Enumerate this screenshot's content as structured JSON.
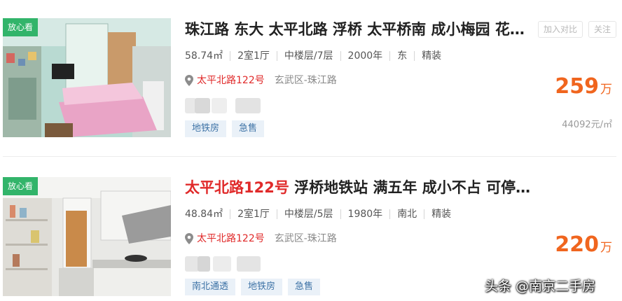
{
  "listings": [
    {
      "badge": "放心看",
      "title": "珠江路 东大 太平北路 浮桥 太平桥南 成小梅园 花…",
      "title_highlight": "",
      "meta": [
        "58.74㎡",
        "2室1厅",
        "中楼层/7层",
        "2000年",
        "东",
        "精装"
      ],
      "address": "太平北路122号",
      "district": "玄武区-珠江路",
      "tags": [
        "地铁房",
        "急售"
      ],
      "price": "259",
      "price_unit": "万",
      "unit_price": "44092元/㎡",
      "compare_label": "加入对比",
      "follow_label": "关注"
    },
    {
      "badge": "放心看",
      "title_highlight": "太平北路122号",
      "title": " 浮桥地铁站 满五年 成小不占 可停…",
      "meta": [
        "48.84㎡",
        "2室1厅",
        "中楼层/5层",
        "1980年",
        "南北",
        "精装"
      ],
      "address": "太平北路122号",
      "district": "玄武区-珠江路",
      "tags": [
        "南北通透",
        "地铁房",
        "急售"
      ],
      "price": "220",
      "price_unit": "万"
    }
  ],
  "watermark": "头条 @南京二手房",
  "colors": {
    "badge_green": "#32b46a",
    "price_orange": "#f0651e",
    "highlight_red": "#e02a2a",
    "tag_bg": "#eaf1f8",
    "tag_text": "#3e73a6"
  }
}
